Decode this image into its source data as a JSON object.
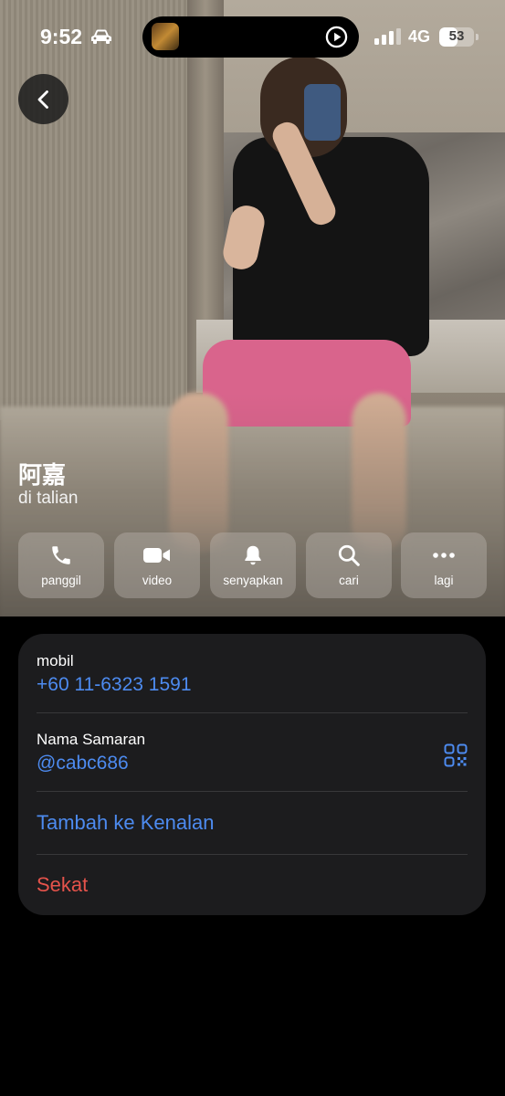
{
  "status_bar": {
    "time": "9:52",
    "network": "4G",
    "battery_level": "53",
    "battery_fraction": 0.53,
    "icons": [
      "car-icon",
      "cellular-signal-icon",
      "battery-icon"
    ]
  },
  "dynamic_island": {
    "icons": [
      "app-thumbnail",
      "play-icon"
    ]
  },
  "contact": {
    "name": "阿嘉",
    "status": "di talian"
  },
  "actions": [
    {
      "label": "panggil",
      "icon": "phone-icon"
    },
    {
      "label": "video",
      "icon": "video-camera-icon"
    },
    {
      "label": "senyapkan",
      "icon": "bell-icon"
    },
    {
      "label": "cari",
      "icon": "search-icon"
    },
    {
      "label": "lagi",
      "icon": "more-dots-icon"
    }
  ],
  "info": {
    "phone_label": "mobil",
    "phone_value": "+60 11-6323 1591",
    "username_label": "Nama Samaran",
    "username_value": "@cabc686",
    "add_contact": "Tambah ke Kenalan",
    "block": "Sekat"
  },
  "colors": {
    "accent": "#4d8bf0",
    "danger": "#e5534b",
    "card_bg": "#1c1c1e",
    "page_bg": "#000000"
  }
}
